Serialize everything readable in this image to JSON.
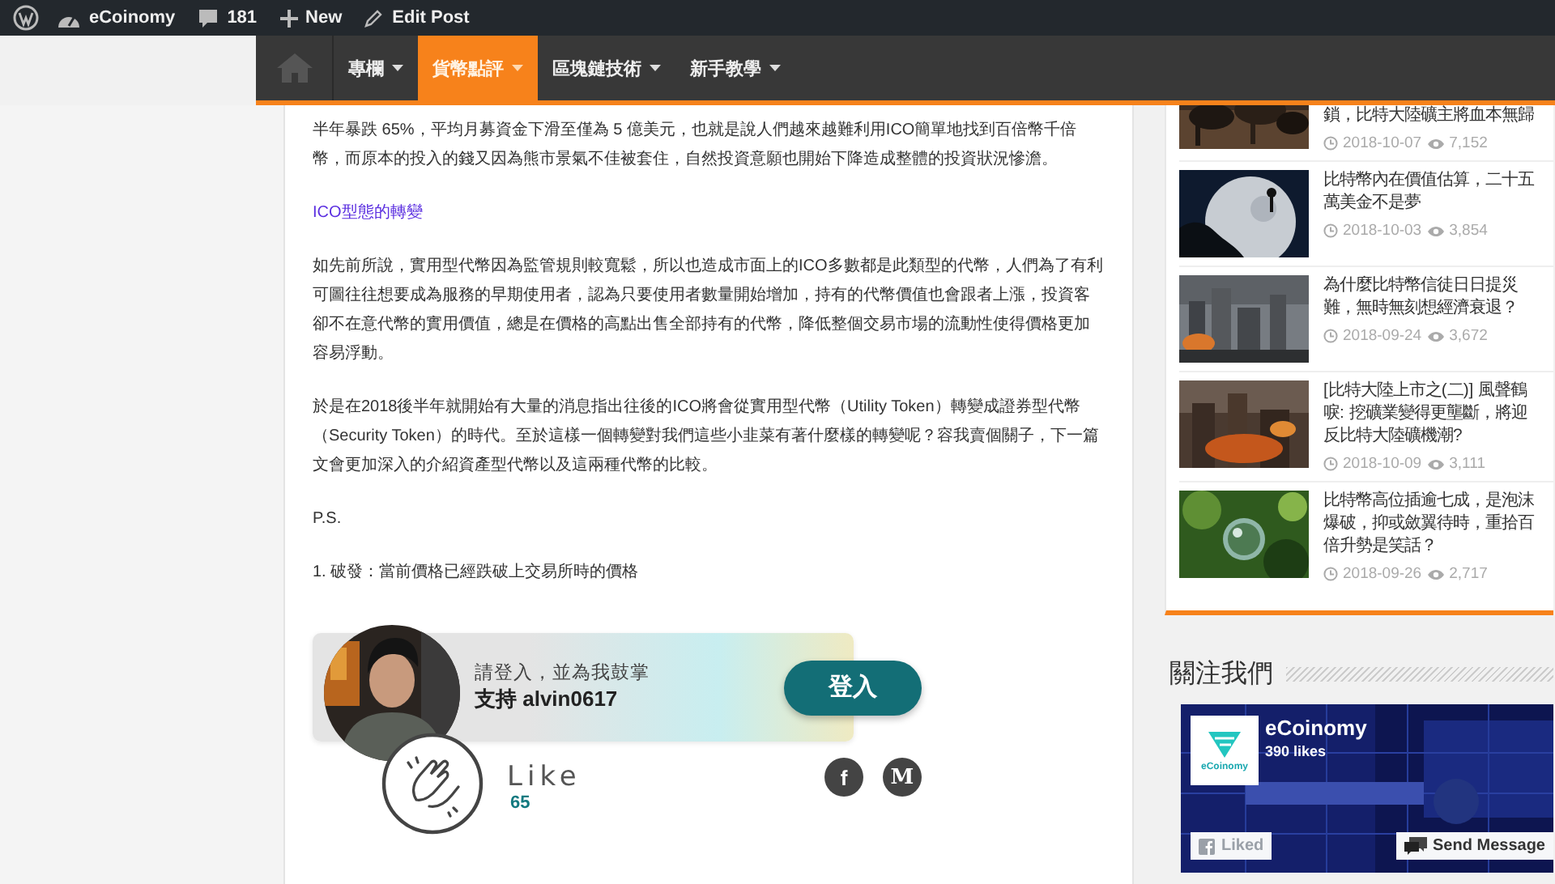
{
  "admin_bar": {
    "site_name": "eCoinomy",
    "comments": "181",
    "new_label": "New",
    "edit_label": "Edit Post"
  },
  "nav": [
    {
      "label": "專欄",
      "selected": false
    },
    {
      "label": "貨幣點評",
      "selected": true
    },
    {
      "label": "區塊鏈技術",
      "selected": false
    },
    {
      "label": "新手教學",
      "selected": false
    }
  ],
  "article": {
    "blocks": [
      {
        "kind": "paragraph",
        "text": "半年暴跌 65%，平均月募資金下滑至僅為 5 億美元，也就是說人們越來越難利用ICO簡單地找到百倍幣千倍幣，而原本的投入的錢又因為熊市景氣不佳被套住，自然投資意願也開始下降造成整體的投資狀況慘澹。"
      },
      {
        "kind": "heading",
        "text": "ICO型態的轉變"
      },
      {
        "kind": "paragraph",
        "text": "如先前所說，實用型代幣因為監管規則較寬鬆，所以也造成市面上的ICO多數都是此類型的代幣，人們為了有利可圖往往想要成為服務的早期使用者，認為只要使用者數量開始增加，持有的代幣價值也會跟者上漲，投資客卻不在意代幣的實用價值，總是在價格的高點出售全部持有的代幣，降低整個交易市場的流動性使得價格更加容易浮動。"
      },
      {
        "kind": "paragraph",
        "text": "於是在2018後半年就開始有大量的消息指出往後的ICO將會從實用型代幣（Utility Token）轉變成證券型代幣（Security Token）的時代。至於這樣一個轉變對我們這些小韭菜有著什麼樣的轉變呢？容我賣個關子，下一篇文會更加深入的介紹資產型代幣以及這兩種代幣的比較。"
      },
      {
        "kind": "paragraph",
        "text": "P.S."
      },
      {
        "kind": "paragraph",
        "text": "1. 破發：當前價格已經跌破上交易所時的價格"
      }
    ]
  },
  "like_widget": {
    "prompt": "請登入，並為我鼓掌",
    "support": "支持 alvin0617",
    "login_button": "登入",
    "like_label": "Like",
    "like_count": "65",
    "share": [
      {
        "kind": "facebook",
        "label": "f"
      },
      {
        "kind": "medium",
        "label": "M"
      }
    ]
  },
  "sidebar": {
    "posts": [
      {
        "title": "鎖，比特大陸礦主將血本無歸",
        "date": "2018-10-07",
        "views": "7,152"
      },
      {
        "title": "比特幣內在價值估算，二十五萬美金不是夢",
        "date": "2018-10-03",
        "views": "3,854"
      },
      {
        "title": "為什麼比特幣信徒日日提災難，無時無刻想經濟衰退？",
        "date": "2018-09-24",
        "views": "3,672"
      },
      {
        "title": "[比特大陸上市之(二)] 風聲鶴唳: 挖礦業變得更壟斷，將迎反比特大陸礦機潮?",
        "date": "2018-10-09",
        "views": "3,111"
      },
      {
        "title": "比特幣高位插逾七成，是泡沫爆破，抑或斂翼待時，重拾百倍升勢是笑話？",
        "date": "2018-09-26",
        "views": "2,717"
      }
    ],
    "follow_heading": "關注我們",
    "facebook_box": {
      "page_name": "eCoinomy",
      "likes": "390 likes",
      "logo_text": "eCoinomy",
      "liked_button": "Liked",
      "message_button": "Send Message"
    }
  }
}
